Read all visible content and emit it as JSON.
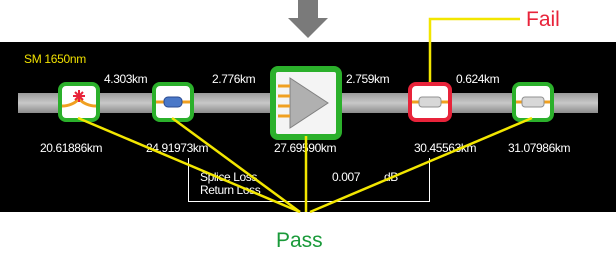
{
  "colors": {
    "pass": "#2bb02b",
    "fail": "#e8233a",
    "callout_line": "#f2e600",
    "mode_label": "#f0e000",
    "fail_text": "#e8233a",
    "pass_text": "#1a9a3a"
  },
  "screen": {
    "mode_label": "SM 1650nm",
    "segments": [
      "4.303km",
      "2.776km",
      "2.759km",
      "0.624km"
    ],
    "events": [
      {
        "type": "connector-fault",
        "status": "pass",
        "position": "20.61886km",
        "icon": "connector-star-icon"
      },
      {
        "type": "splice",
        "status": "pass",
        "position": "24.91973km",
        "icon": "splice-icon"
      },
      {
        "type": "splitter",
        "status": "pass",
        "position": "27.69590km",
        "icon": "splitter-icon"
      },
      {
        "type": "connector",
        "status": "fail",
        "position": "30.45563km",
        "icon": "connector-icon"
      },
      {
        "type": "connector",
        "status": "pass",
        "position": "31.07986km",
        "icon": "connector-icon"
      }
    ],
    "info": {
      "splice_loss_label": "Splice Loss",
      "splice_loss_value": "0.007",
      "splice_loss_unit": "dB",
      "return_loss_label": "Return Loss"
    }
  },
  "callouts": {
    "fail": "Fail",
    "pass": "Pass"
  }
}
